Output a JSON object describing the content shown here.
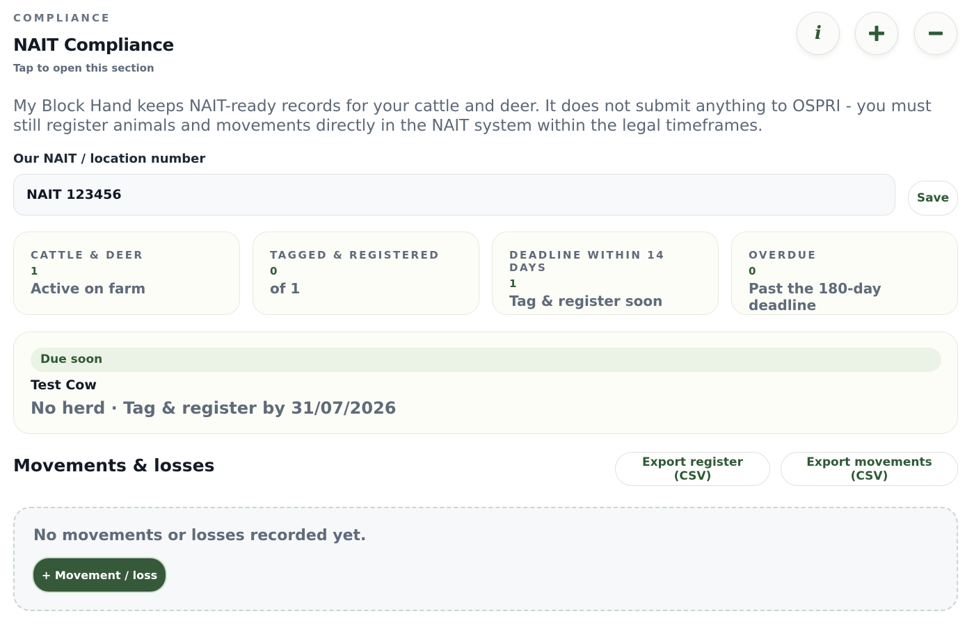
{
  "header": {
    "eyebrow": "COMPLIANCE",
    "title": "NAIT Compliance",
    "hint": "Tap to open this section",
    "info_icon": "info-icon",
    "expand_icon": "plus-icon",
    "collapse_icon": "minus-icon"
  },
  "intro": "My Block Hand keeps NAIT-ready records for your cattle and deer. It does not submit anything to OSPRI - you must still register animals and movements directly in the NAIT system within the legal timeframes.",
  "nait": {
    "label": "Our NAIT / location number",
    "value": "NAIT 123456",
    "save_label": "Save"
  },
  "stats": [
    {
      "label": "CATTLE & DEER",
      "value": "1",
      "sub": "Active on farm"
    },
    {
      "label": "TAGGED & REGISTERED",
      "value": "0",
      "sub": "of 1"
    },
    {
      "label": "DEADLINE WITHIN 14 DAYS",
      "value": "1",
      "sub": "Tag & register soon"
    },
    {
      "label": "OVERDUE",
      "value": "0",
      "sub": "Past the 180-day deadline"
    }
  ],
  "due": {
    "badge": "Due soon",
    "name": "Test Cow",
    "detail": "No herd · Tag & register by 31/07/2026"
  },
  "movements": {
    "title": "Movements & losses",
    "export_register": "Export register (CSV)",
    "export_movements": "Export movements (CSV)",
    "empty_text": "No movements or losses recorded yet.",
    "add_label": "+ Movement / loss"
  },
  "colors": {
    "accent": "#2f5a36",
    "button_dark": "#36593a",
    "badge_bg": "#eaf3e5",
    "card_bg": "#fdfdf7"
  }
}
